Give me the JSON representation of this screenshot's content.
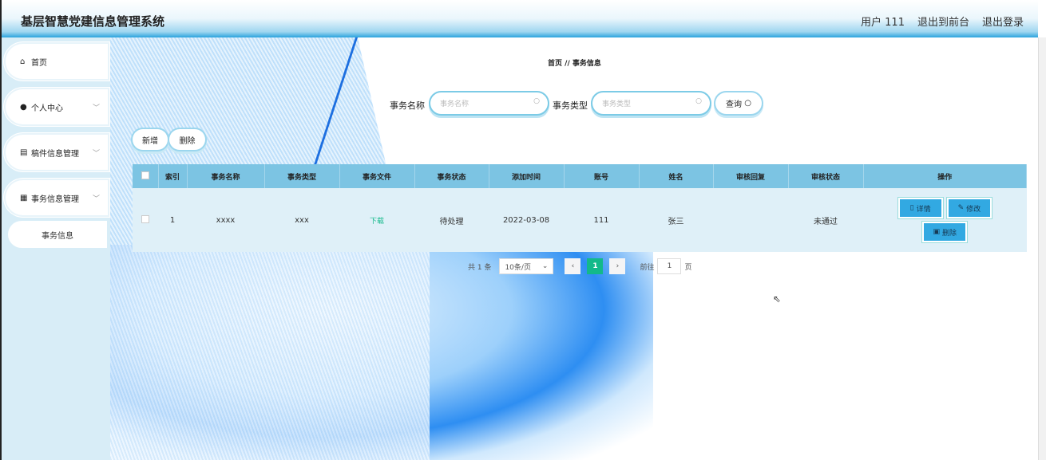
{
  "header": {
    "title": "基层智慧党建信息管理系统",
    "user": "用户 111",
    "to_front": "退出到前台",
    "logout": "退出登录"
  },
  "sidebar": {
    "items": [
      {
        "label": "首页",
        "icon": "home-icon"
      },
      {
        "label": "个人中心",
        "icon": "user-icon"
      },
      {
        "label": "稿件信息管理",
        "icon": "document-icon"
      },
      {
        "label": "事务信息管理",
        "icon": "grid-icon"
      }
    ],
    "sub": "事务信息"
  },
  "breadcrumb": {
    "home": "首页",
    "sep": "//",
    "current": "事务信息"
  },
  "search": {
    "name_label": "事务名称",
    "name_placeholder": "事务名称",
    "type_label": "事务类型",
    "type_placeholder": "事务类型",
    "query": "查询"
  },
  "actions": {
    "add": "新增",
    "delete": "删除"
  },
  "table": {
    "headers": [
      "索引",
      "事务名称",
      "事务类型",
      "事务文件",
      "事务状态",
      "添加时间",
      "账号",
      "姓名",
      "审核回复",
      "审核状态",
      "操作"
    ],
    "rows": [
      {
        "index": "1",
        "name": "xxxx",
        "type": "xxx",
        "file": "下载",
        "status": "待处理",
        "time": "2022-03-08",
        "account": "111",
        "person": "张三",
        "reply": "",
        "audit": "未通过"
      }
    ],
    "detail": "详情",
    "edit": "修改",
    "del": "删除"
  },
  "pagination": {
    "total": "共 1 条",
    "page_size": "10条/页",
    "current": "1",
    "goto": "前往",
    "goto_value": "1",
    "page_unit": "页"
  },
  "colors": {
    "header_th": "#7cc4e3",
    "row_bg": "#dff0f8",
    "op_button": "#32a9e2",
    "active_page": "#13b98a"
  }
}
